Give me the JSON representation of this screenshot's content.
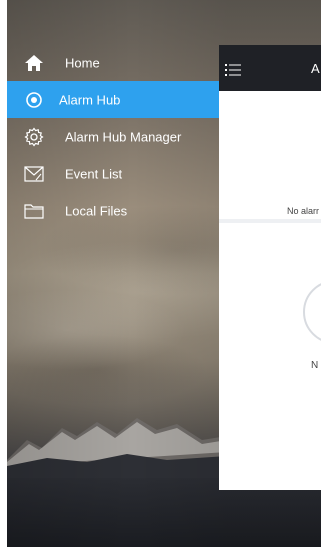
{
  "drawer": {
    "items": [
      {
        "label": "Home",
        "icon": "home-icon",
        "active": false
      },
      {
        "label": "Alarm Hub",
        "icon": "radio-target-icon",
        "active": true
      },
      {
        "label": "Alarm Hub Manager",
        "icon": "gear-icon",
        "active": false
      },
      {
        "label": "Event List",
        "icon": "mail-icon",
        "active": false
      },
      {
        "label": "Local Files",
        "icon": "folder-icon",
        "active": false
      }
    ],
    "active_color": "#2ea1ee"
  },
  "app_panel": {
    "title_partial": "A",
    "card_message_partial": "No alarr",
    "lower_message_partial": "N"
  }
}
